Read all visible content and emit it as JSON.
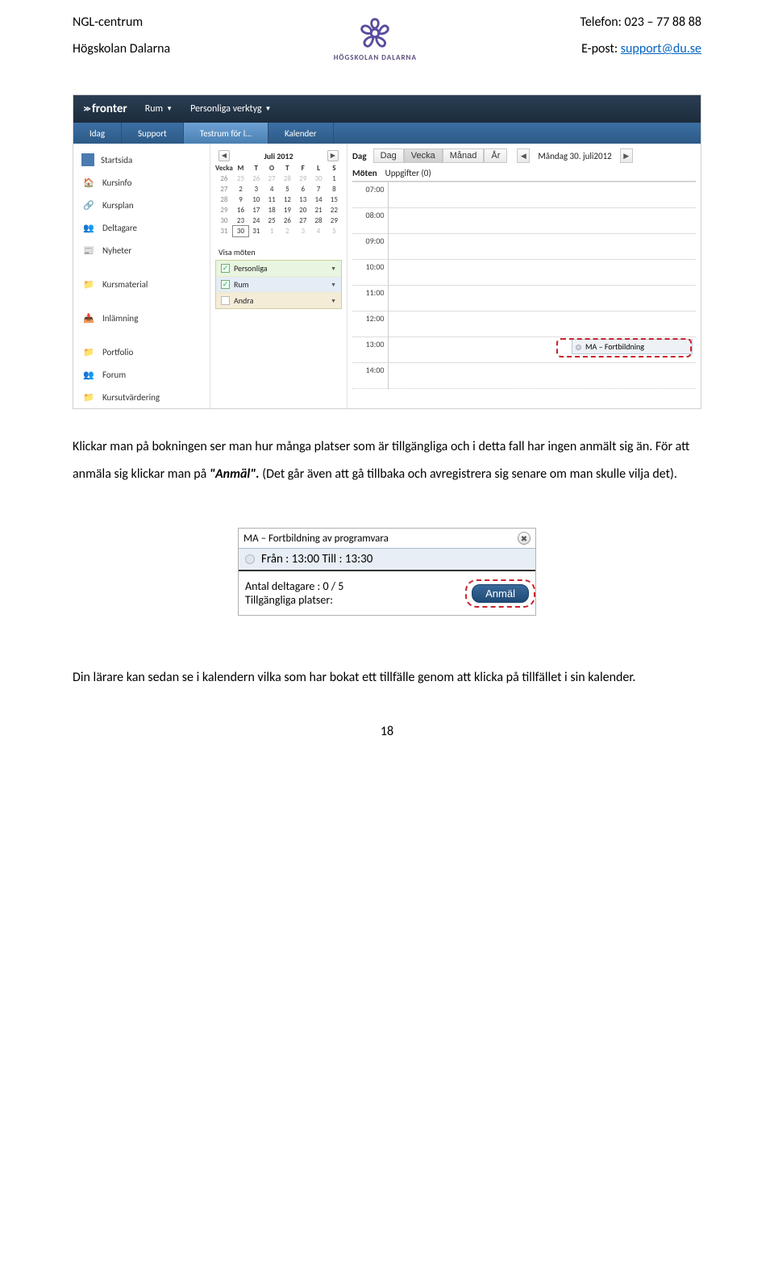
{
  "header": {
    "left": {
      "line1": "NGL-centrum",
      "line2": "Högskolan Dalarna"
    },
    "right": {
      "line1": "Telefon: 023 – 77 88 88",
      "line2_prefix": "E-post: ",
      "email": "support@du.se"
    },
    "logo_text": "HÖGSKOLAN DALARNA"
  },
  "app": {
    "brand": "fronter",
    "menus": [
      {
        "label": "Rum"
      },
      {
        "label": "Personliga verktyg"
      }
    ],
    "tabs": [
      {
        "label": "Idag"
      },
      {
        "label": "Support"
      },
      {
        "label": "Testrum för I…"
      },
      {
        "label": "Kalender"
      }
    ],
    "sidebar": [
      {
        "label": "Startsida"
      },
      {
        "label": "Kursinfo"
      },
      {
        "label": "Kursplan"
      },
      {
        "label": "Deltagare"
      },
      {
        "label": "Nyheter"
      },
      {
        "gap": true
      },
      {
        "label": "Kursmaterial"
      },
      {
        "gap": true
      },
      {
        "label": "Inlämning"
      },
      {
        "gap": true
      },
      {
        "label": "Portfolio"
      },
      {
        "label": "Forum"
      },
      {
        "label": "Kursutvärdering"
      }
    ],
    "mini_calendar": {
      "title": "Juli 2012",
      "week_head": "Vecka",
      "day_heads": [
        "M",
        "T",
        "O",
        "T",
        "F",
        "L",
        "S"
      ],
      "rows": [
        {
          "wk": "26",
          "days": [
            "25",
            "26",
            "27",
            "28",
            "29",
            "30",
            "1"
          ],
          "other": [
            0,
            1,
            2,
            3,
            4,
            5
          ]
        },
        {
          "wk": "27",
          "days": [
            "2",
            "3",
            "4",
            "5",
            "6",
            "7",
            "8"
          ]
        },
        {
          "wk": "28",
          "days": [
            "9",
            "10",
            "11",
            "12",
            "13",
            "14",
            "15"
          ]
        },
        {
          "wk": "29",
          "days": [
            "16",
            "17",
            "18",
            "19",
            "20",
            "21",
            "22"
          ]
        },
        {
          "wk": "30",
          "days": [
            "23",
            "24",
            "25",
            "26",
            "27",
            "28",
            "29"
          ]
        },
        {
          "wk": "31",
          "days": [
            "30",
            "31",
            "1",
            "2",
            "3",
            "4",
            "5"
          ],
          "other": [
            2,
            3,
            4,
            5,
            6
          ],
          "today_idx": 0
        }
      ]
    },
    "show_meetings": {
      "title": "Visa möten",
      "rows": [
        {
          "label": "Personliga",
          "checked": true,
          "cls": "row-green"
        },
        {
          "label": "Rum",
          "checked": true,
          "cls": "row-blue"
        },
        {
          "label": "Andra",
          "checked": false,
          "cls": "row-tan"
        }
      ]
    },
    "day_view": {
      "head_label": "Dag",
      "buttons": [
        {
          "label": "Dag",
          "active": false,
          "name": "view-day"
        },
        {
          "label": "Vecka",
          "active": true,
          "name": "view-week"
        },
        {
          "label": "Månad",
          "active": false,
          "name": "view-month"
        },
        {
          "label": "År",
          "active": false,
          "name": "view-year"
        }
      ],
      "date_label": "Måndag 30. juli2012",
      "col_head1": "Möten",
      "col_head2": "Uppgifter (0)",
      "times": [
        "07:00",
        "08:00",
        "09:00",
        "10:00",
        "11:00",
        "12:00",
        "13:00",
        "14:00"
      ],
      "event": {
        "time": "13:00",
        "label": "MA – Fortbildning"
      }
    }
  },
  "paragraph1": {
    "t1": "Klickar man på bokningen ser man hur många platser som är tillgängliga och i detta fall har ingen anmält sig än. För att anmäla sig klickar man på ",
    "em": "\"Anmäl\".",
    "t2": " (Det går även att gå tillbaka och avregistrera sig senare om man skulle vilja det)."
  },
  "popup": {
    "title": "MA – Fortbildning av programvara",
    "time": "Från : 13:00 Till : 13:30",
    "participants_line1": "Antal deltagare : 0 / 5",
    "participants_line2": "Tillgängliga platser:",
    "button": "Anmäl"
  },
  "paragraph2": {
    "t": "Din lärare kan sedan se i kalendern vilka som har bokat ett tillfälle genom att klicka på tillfället i sin kalender."
  },
  "page_number": "18"
}
